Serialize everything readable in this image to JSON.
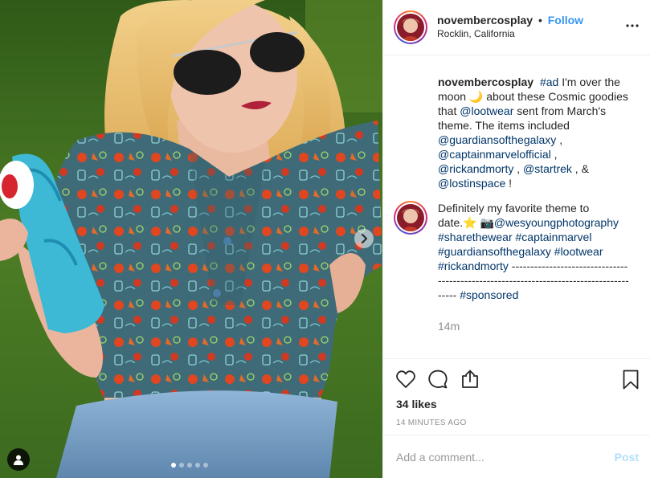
{
  "media": {
    "image_description_icon": "photo",
    "carousel": {
      "count": 5,
      "active": 0
    },
    "next_icon": "chevron-right-icon",
    "user_tag_icon": "person-icon"
  },
  "header": {
    "username": "novembercosplay",
    "separator": "•",
    "follow_label": "Follow",
    "location": "Rocklin, California",
    "more_icon": "more-horizontal-icon"
  },
  "caption": {
    "username": "novembercosplay",
    "parts": [
      {
        "t": "text",
        "v": ""
      },
      {
        "t": "link",
        "v": "#ad"
      },
      {
        "t": "text",
        "v": " I'm over the moon 🌙 about these Cosmic goodies that "
      },
      {
        "t": "link",
        "v": "@lootwear"
      },
      {
        "t": "text",
        "v": " sent from March's theme. The items included "
      },
      {
        "t": "link",
        "v": "@guardiansofthegalaxy"
      },
      {
        "t": "text",
        "v": " , "
      },
      {
        "t": "link",
        "v": "@captainmarvelofficial"
      },
      {
        "t": "text",
        "v": " , "
      },
      {
        "t": "link",
        "v": "@rickandmorty"
      },
      {
        "t": "text",
        "v": " , "
      },
      {
        "t": "link",
        "v": "@startrek"
      },
      {
        "t": "text",
        "v": " , & "
      },
      {
        "t": "link",
        "v": "@lostinspace"
      },
      {
        "t": "text",
        "v": " !"
      }
    ]
  },
  "comment": {
    "parts": [
      {
        "t": "text",
        "v": "Definitely my favorite theme to date.⭐ 📷"
      },
      {
        "t": "link",
        "v": "@wesyoungphotography"
      },
      {
        "t": "text",
        "v": " "
      },
      {
        "t": "link",
        "v": "#sharethewear"
      },
      {
        "t": "text",
        "v": " "
      },
      {
        "t": "link",
        "v": "#captainmarvel"
      },
      {
        "t": "text",
        "v": " "
      },
      {
        "t": "link",
        "v": "#guardiansofthegalaxy"
      },
      {
        "t": "text",
        "v": " "
      },
      {
        "t": "link",
        "v": "#lootwear"
      },
      {
        "t": "text",
        "v": " "
      },
      {
        "t": "link",
        "v": "#rickandmorty"
      },
      {
        "t": "text",
        "v": " --------------------------------------------------------------------------------------- "
      },
      {
        "t": "link",
        "v": "#sponsored"
      }
    ],
    "time": "14m"
  },
  "actions": {
    "like_icon": "heart-icon",
    "comment_icon": "comment-icon",
    "share_icon": "share-icon",
    "save_icon": "bookmark-icon",
    "likes_text": "34 likes",
    "timestamp": "14 MINUTES AGO"
  },
  "add_comment": {
    "placeholder": "Add a comment...",
    "post_label": "Post"
  },
  "colors": {
    "link": "#003569",
    "follow": "#3897f0",
    "post_disabled": "#b2dffc",
    "muted": "#8e8e8e"
  }
}
